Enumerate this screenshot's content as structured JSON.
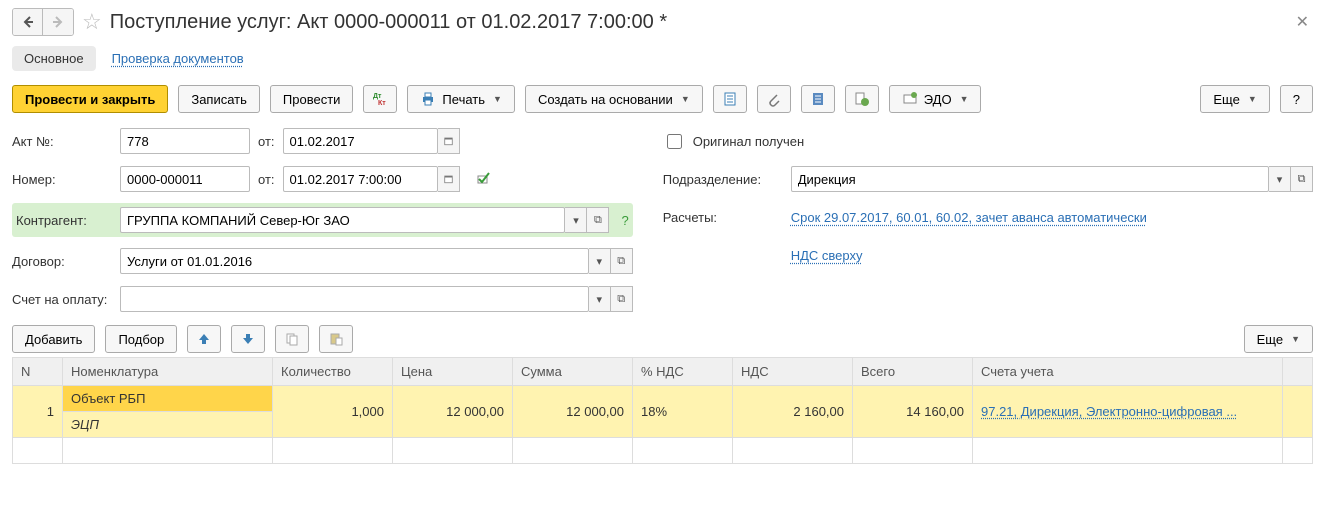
{
  "header": {
    "title": "Поступление услуг: Акт 0000-000011 от 01.02.2017 7:00:00 *"
  },
  "tabs": {
    "main": "Основное",
    "check": "Проверка документов"
  },
  "toolbar": {
    "post_close": "Провести и закрыть",
    "save": "Записать",
    "post": "Провести",
    "print": "Печать",
    "create_based": "Создать на основании",
    "edo": "ЭДО",
    "more": "Еще",
    "help": "?"
  },
  "form": {
    "act_no_label": "Акт №:",
    "act_no_value": "778",
    "from_label": "от:",
    "act_date": "01.02.2017",
    "number_label": "Номер:",
    "number_value": "0000-000011",
    "number_date": "01.02.2017 7:00:00",
    "counterparty_label": "Контрагент:",
    "counterparty_value": "ГРУППА КОМПАНИЙ Север-Юг ЗАО",
    "counterparty_help": "?",
    "contract_label": "Договор:",
    "contract_value": "Услуги от 01.01.2016",
    "invoice_label": "Счет на оплату:",
    "original_label": "Оригинал получен",
    "division_label": "Подразделение:",
    "division_value": "Дирекция",
    "calc_label": "Расчеты:",
    "calc_link": "Срок 29.07.2017, 60.01, 60.02, зачет аванса автоматически",
    "vat_link": "НДС сверху"
  },
  "table_toolbar": {
    "add": "Добавить",
    "pick": "Подбор",
    "more": "Еще"
  },
  "table": {
    "headers": {
      "n": "N",
      "name": "Номенклатура",
      "qty": "Количество",
      "price": "Цена",
      "sum": "Сумма",
      "vat_pct": "% НДС",
      "vat": "НДС",
      "total": "Всего",
      "accounts": "Счета учета"
    },
    "rows": [
      {
        "n": "1",
        "name": "Объект РБП",
        "sub": "ЭЦП",
        "qty": "1,000",
        "price": "12 000,00",
        "sum": "12 000,00",
        "vat_pct": "18%",
        "vat": "2 160,00",
        "total": "14 160,00",
        "accounts": "97.21, Дирекция, Электронно-цифровая ..."
      }
    ]
  }
}
